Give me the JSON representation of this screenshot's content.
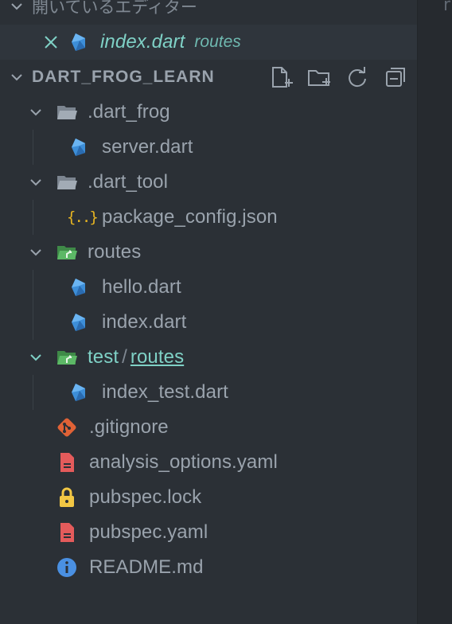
{
  "open_editors": {
    "title": "開いているエディター",
    "items": [
      {
        "file": "index.dart",
        "folder": "routes"
      }
    ]
  },
  "explorer": {
    "root": "DART_FROG_LEARN",
    "actions": [
      "new-file-icon",
      "new-folder-icon",
      "refresh-icon",
      "collapse-all-icon"
    ],
    "rows": [
      {
        "label": ".dart_frog",
        "type": "folder"
      },
      {
        "label": "server.dart",
        "type": "dart"
      },
      {
        "label": ".dart_tool",
        "type": "folder"
      },
      {
        "label": "package_config.json",
        "type": "json"
      },
      {
        "label": "routes",
        "type": "folder-green"
      },
      {
        "label": "hello.dart",
        "type": "dart"
      },
      {
        "label": "index.dart",
        "type": "dart"
      },
      {
        "label": "test",
        "type": "folder-green",
        "compact_sep": "/",
        "compact_child": "routes"
      },
      {
        "label": "index_test.dart",
        "type": "dart"
      },
      {
        "label": ".gitignore",
        "type": "git"
      },
      {
        "label": "analysis_options.yaml",
        "type": "yaml"
      },
      {
        "label": "pubspec.lock",
        "type": "lock"
      },
      {
        "label": "pubspec.yaml",
        "type": "yaml"
      },
      {
        "label": "README.md",
        "type": "info"
      }
    ]
  },
  "colors": {
    "background": "#2b3036",
    "text": "#9aa3ad",
    "accent_teal": "#7fd1c6",
    "dart_blue": "#3d8ed8",
    "folder_green": "#4e9e57",
    "git_orange": "#e06236",
    "yaml_red": "#e45b5b",
    "lock_yellow": "#f2c744",
    "info_blue": "#4a90e2"
  },
  "editor_fragment": "r"
}
